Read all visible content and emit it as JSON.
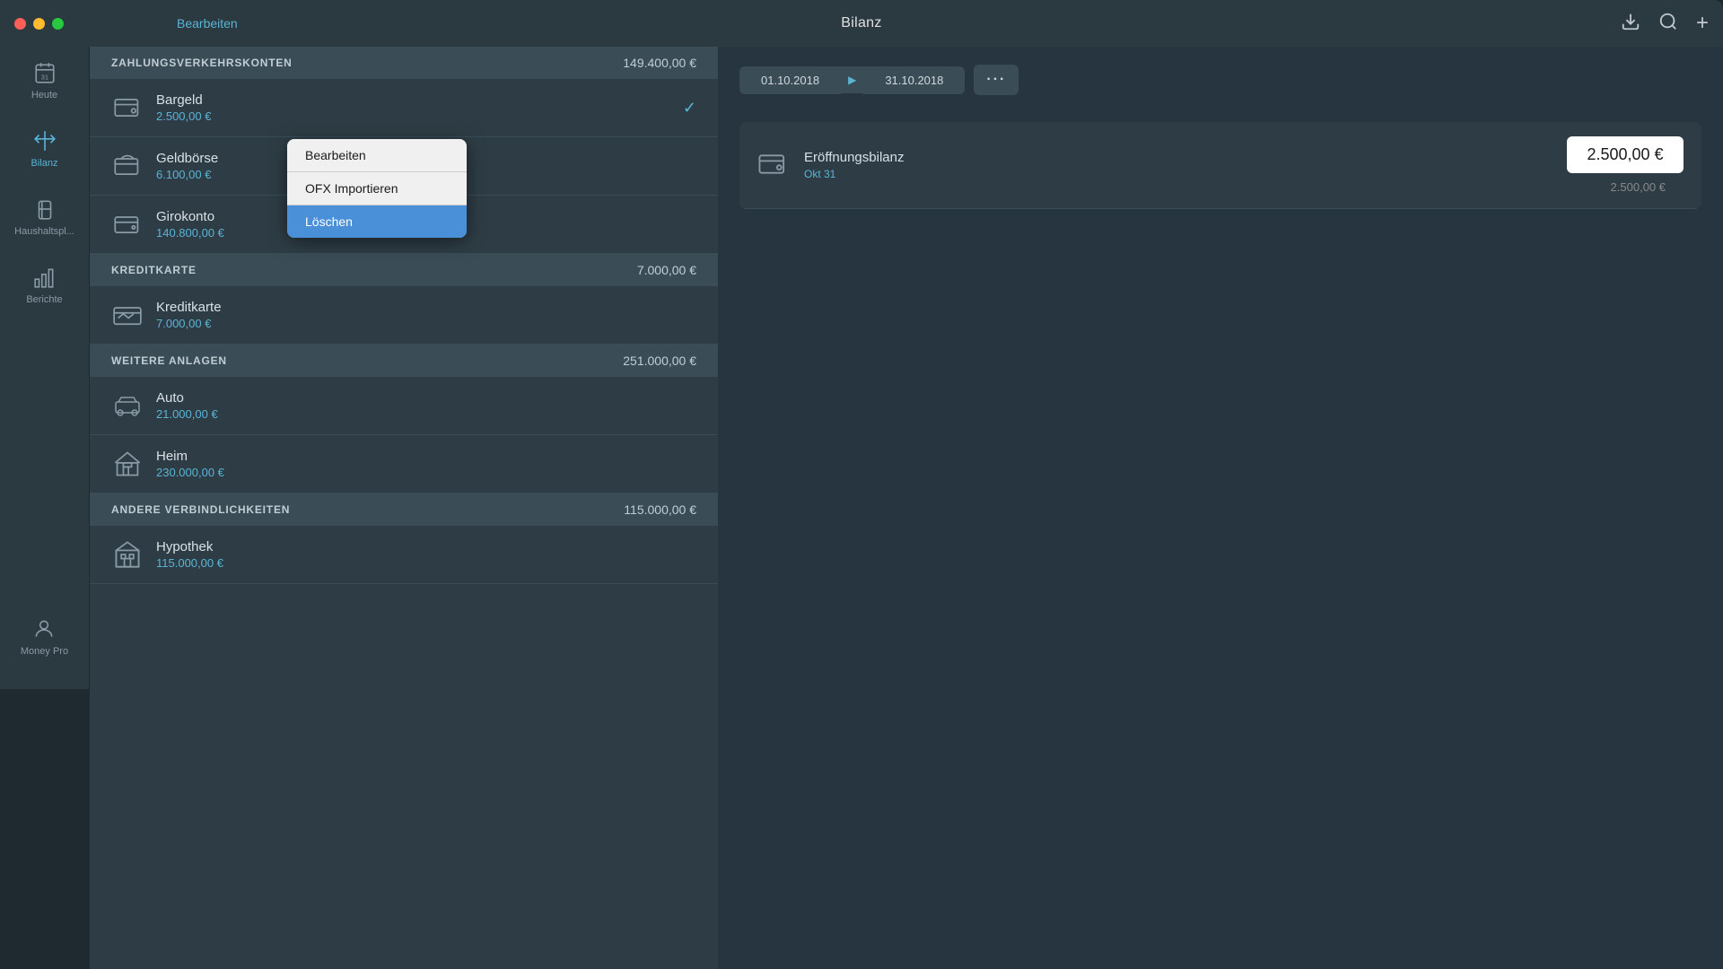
{
  "app": {
    "name": "Money Pro"
  },
  "titlebar": {
    "title": "Bilanz",
    "edit_label": "Bearbeiten",
    "download_icon": "⬇",
    "search_icon": "🔍",
    "add_icon": "+"
  },
  "sidebar": {
    "items": [
      {
        "id": "heute",
        "label": "Heute",
        "icon": "calendar"
      },
      {
        "id": "bilanz",
        "label": "Bilanz",
        "icon": "scale",
        "active": true
      },
      {
        "id": "haushalt",
        "label": "Haushaltspl...",
        "icon": "battery"
      },
      {
        "id": "berichte",
        "label": "Berichte",
        "icon": "chart"
      }
    ],
    "bottom": {
      "label": "Money Pro",
      "icon": "person"
    }
  },
  "sections": [
    {
      "id": "zahlungsverkehrskonten",
      "title": "ZAHLUNGSVERKEHRSKONTEN",
      "amount": "149.400,00 €",
      "accounts": [
        {
          "id": "bargeld",
          "name": "Bargeld",
          "balance": "2.500,00 €",
          "icon": "wallet",
          "checked": true
        },
        {
          "id": "geldborse",
          "name": "Geldbörse",
          "balance": "6.100,00 €",
          "icon": "wallet2",
          "checked": false
        },
        {
          "id": "girokonto",
          "name": "Girokonto",
          "balance": "140.800,00 €",
          "icon": "wallet3",
          "checked": false
        }
      ]
    },
    {
      "id": "kreditkarte",
      "title": "KREDITKARTE",
      "amount": "7.000,00 €",
      "accounts": [
        {
          "id": "kreditkarte",
          "name": "Kreditkarte",
          "balance": "7.000,00 €",
          "icon": "card",
          "checked": false
        }
      ]
    },
    {
      "id": "weitere-anlagen",
      "title": "WEITERE ANLAGEN",
      "amount": "251.000,00 €",
      "accounts": [
        {
          "id": "auto",
          "name": "Auto",
          "balance": "21.000,00 €",
          "icon": "car",
          "checked": false
        },
        {
          "id": "heim",
          "name": "Heim",
          "balance": "230.000,00 €",
          "icon": "house",
          "checked": false
        }
      ]
    },
    {
      "id": "andere-verbindlichkeiten",
      "title": "ANDERE VERBINDLICHKEITEN",
      "amount": "115.000,00 €",
      "accounts": [
        {
          "id": "hypothek",
          "name": "Hypothek",
          "balance": "115.000,00 €",
          "icon": "building",
          "checked": false
        }
      ]
    }
  ],
  "context_menu": {
    "items": [
      {
        "id": "bearbeiten",
        "label": "Bearbeiten",
        "active": false
      },
      {
        "id": "ofx",
        "label": "OFX Importieren",
        "active": false
      },
      {
        "id": "loschen",
        "label": "Löschen",
        "active": true
      }
    ]
  },
  "right_panel": {
    "date_start": "01.10.2018",
    "date_end": "31.10.2018",
    "more_label": "···",
    "transaction": {
      "name": "Eröffnungsbilanz",
      "date": "Okt 31",
      "amount_main": "2.500,00 €",
      "amount_sub": "2.500,00 €",
      "icon": "wallet"
    }
  }
}
